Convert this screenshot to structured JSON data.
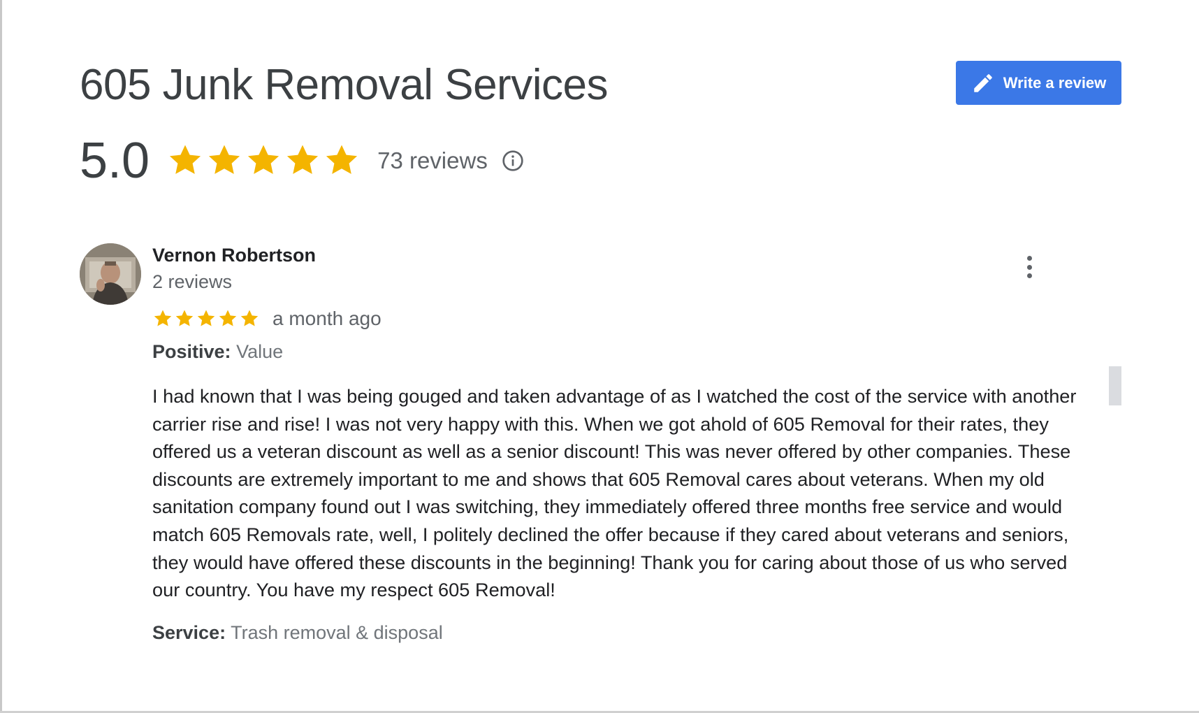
{
  "business": {
    "title": "605 Junk Removal Services",
    "rating": "5.0",
    "rating_stars": 5,
    "reviews_count": "73 reviews"
  },
  "actions": {
    "write_review_label": "Write a review"
  },
  "icons": {
    "write_review": "pencil-icon",
    "info": "info-icon",
    "star": "star-icon",
    "more": "more-vert-icon"
  },
  "review": {
    "author": "Vernon Robertson",
    "author_meta": "2 reviews",
    "stars": 5,
    "date": "a month ago",
    "positive_label": "Positive:",
    "positive_value": "Value",
    "text": "I had known that I was being gouged and taken advantage of as I watched the cost of the service with another carrier rise and rise! I was not very happy with this. When we got ahold of 605 Removal for their rates, they offered us a veteran discount as well as a senior discount! This was never offered by other companies. These discounts are extremely important to me and shows that 605 Removal cares about veterans. When my old sanitation company found out I was switching, they immediately offered three months free service and would match 605 Removals rate, well, I politely declined the offer because if they cared about veterans and seniors, they would have offered these discounts in the beginning! Thank you for caring about those of us who served our country. You have my respect 605 Removal!",
    "service_label": "Service:",
    "service_value": "Trash removal & disposal"
  },
  "colors": {
    "accent": "#3b78e7",
    "star": "#f4b400",
    "title": "#3c4043",
    "secondary_text": "#5f6368"
  }
}
